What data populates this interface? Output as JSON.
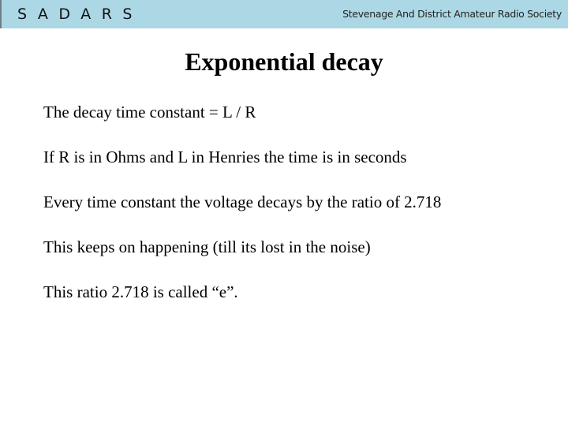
{
  "header": {
    "logo": "SADARS",
    "society_name": "Stevenage And District Amateur Radio Society",
    "background_color": "#acd8e6"
  },
  "slide": {
    "title": "Exponential decay",
    "bullets": [
      "The decay time constant = L / R",
      "If R is in Ohms and L in Henries the time is in seconds",
      "Every time constant the voltage decays by the ratio of 2.718",
      "This keeps on happening (till its lost in the noise)",
      "This ratio 2.718 is called “e”."
    ]
  }
}
